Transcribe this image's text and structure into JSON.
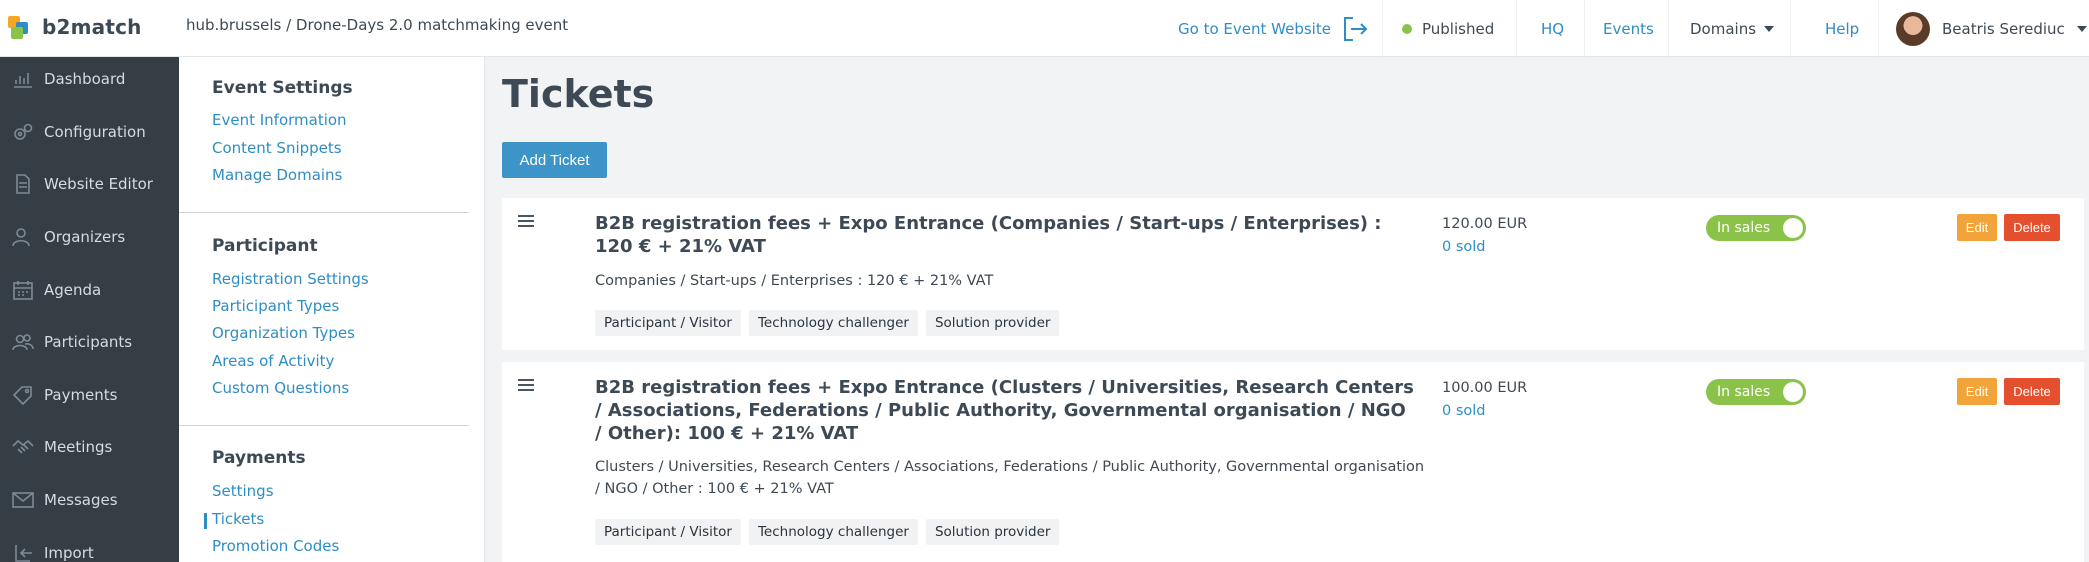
{
  "header": {
    "brand": "b2match",
    "breadcrumb": "hub.brussels / Drone-Days 2.0 matchmaking event",
    "goto_label": "Go to Event Website",
    "status_label": "Published",
    "nav": [
      "HQ",
      "Events",
      "Domains",
      "Help"
    ],
    "user_name": "Beatris Serediuc"
  },
  "sidebar": {
    "items": [
      {
        "label": "Dashboard",
        "icon": "chart-icon"
      },
      {
        "label": "Configuration",
        "icon": "gears-icon"
      },
      {
        "label": "Website Editor",
        "icon": "document-icon"
      },
      {
        "label": "Organizers",
        "icon": "users-icon"
      },
      {
        "label": "Agenda",
        "icon": "calendar-icon"
      },
      {
        "label": "Participants",
        "icon": "people-icon"
      },
      {
        "label": "Payments",
        "icon": "tag-icon"
      },
      {
        "label": "Meetings",
        "icon": "handshake-icon"
      },
      {
        "label": "Messages",
        "icon": "envelope-icon"
      },
      {
        "label": "Import",
        "icon": "import-icon"
      }
    ]
  },
  "submenu": {
    "sections": [
      {
        "heading": "Event Settings",
        "links": [
          "Event Information",
          "Content Snippets",
          "Manage Domains"
        ]
      },
      {
        "heading": "Participant",
        "links": [
          "Registration Settings",
          "Participant Types",
          "Organization Types",
          "Areas of Activity",
          "Custom Questions"
        ]
      },
      {
        "heading": "Payments",
        "links": [
          "Settings",
          "Tickets",
          "Promotion Codes"
        ]
      }
    ],
    "active": "Tickets"
  },
  "main": {
    "title": "Tickets",
    "add_label": "Add Ticket",
    "tickets": [
      {
        "title": "B2B registration fees + Expo Entrance (Companies / Start-ups / Enterprises) : 120 € + 21% VAT",
        "description": "Companies / Start-ups / Enterprises : 120 € + 21% VAT",
        "tags": [
          "Participant / Visitor",
          "Technology challenger",
          "Solution provider"
        ],
        "price": "120.00 EUR",
        "sold": "0 sold",
        "toggle_label": "In sales",
        "edit_label": "Edit",
        "delete_label": "Delete"
      },
      {
        "title": "B2B registration fees + Expo Entrance (Clusters / Universities, Research Centers / Associations, Federations / Public Authority, Governmental organisation / NGO / Other): 100 € + 21% VAT",
        "description": "Clusters / Universities, Research Centers / Associations, Federations / Public Authority, Governmental organisation / NGO / Other : 100 € + 21% VAT",
        "tags": [
          "Participant / Visitor",
          "Technology challenger",
          "Solution provider"
        ],
        "price": "100.00 EUR",
        "sold": "0 sold",
        "toggle_label": "In sales",
        "edit_label": "Edit",
        "delete_label": "Delete"
      }
    ]
  },
  "colors": {
    "accent": "#2e8ec4",
    "sidebar_bg": "#353d45",
    "published": "#8bc34a",
    "edit": "#f2a33a",
    "delete": "#e4502e"
  }
}
